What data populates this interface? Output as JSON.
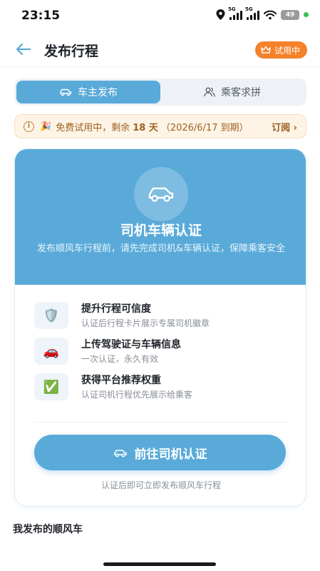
{
  "status_bar": {
    "time": "23:15",
    "signal_1_label": "5G",
    "signal_2_label": "5G",
    "battery": "49"
  },
  "header": {
    "title": "发布行程",
    "trial_badge": "试用中"
  },
  "tabs": [
    {
      "label": "车主发布",
      "active": true
    },
    {
      "label": "乘客求拼",
      "active": false
    }
  ],
  "notice": {
    "prefix": "免费试用中，剩余",
    "days": "18 天",
    "suffix": "（2026/6/17 到期）",
    "action": "订阅 ›"
  },
  "card": {
    "title": "司机车辆认证",
    "description": "发布顺风车行程前，请先完成司机&车辆认证，保障乘客安全",
    "features": [
      {
        "icon": "shield-icon",
        "emoji": "🛡️",
        "title": "提升行程可信度",
        "subtitle": "认证后行程卡片展示专属司机徽章"
      },
      {
        "icon": "red-car-icon",
        "emoji": "🚗",
        "title": "上传驾驶证与车辆信息",
        "subtitle": "一次认证，永久有效"
      },
      {
        "icon": "check-mark-icon",
        "emoji": "✅",
        "title": "获得平台推荐权重",
        "subtitle": "认证司机行程优先展示给乘客"
      }
    ],
    "cta_label": "前往司机认证",
    "hint": "认证后即可立即发布顺风车行程"
  },
  "section": {
    "title": "我发布的顺风车"
  },
  "colors": {
    "primary": "#5aaad9",
    "trial_orange": "#f5822b",
    "notice_bg": "#fdf4e6",
    "notice_text": "#a0601f"
  }
}
